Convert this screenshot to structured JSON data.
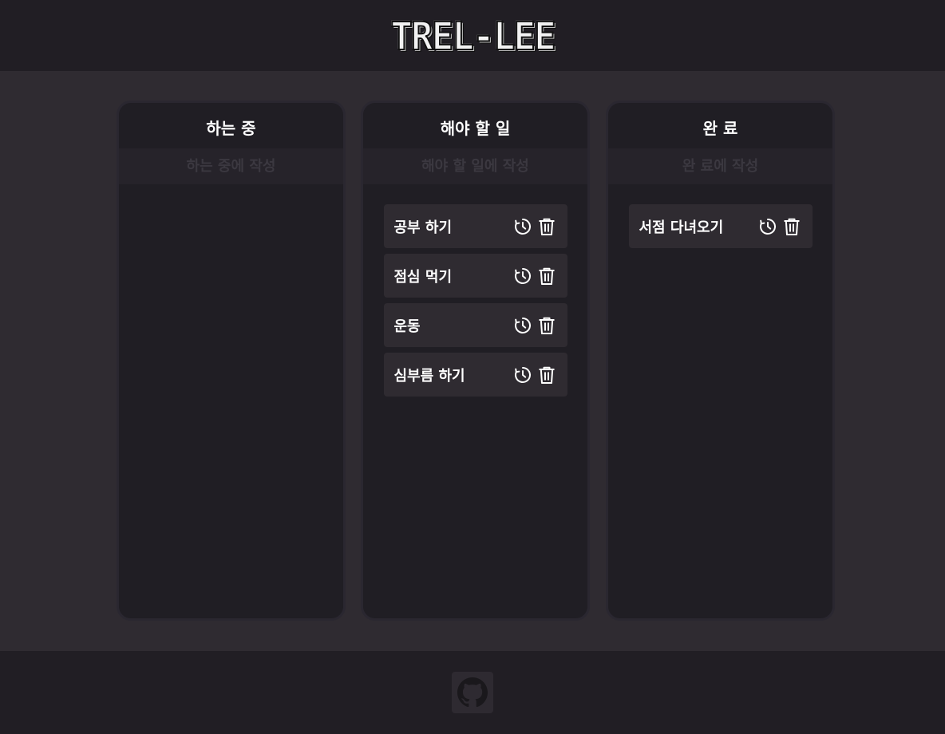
{
  "header": {
    "logo_text": "TREL-LEE"
  },
  "boards": [
    {
      "title": "하는 중",
      "input_placeholder": "하는 중에 작성",
      "cards": []
    },
    {
      "title": "해야 할 일",
      "input_placeholder": "해야 할 일에 작성",
      "cards": [
        {
          "text": "공부 하기"
        },
        {
          "text": "점심 먹기"
        },
        {
          "text": "운동"
        },
        {
          "text": "심부름 하기"
        }
      ]
    },
    {
      "title": "완 료",
      "input_placeholder": "완 료에 작성",
      "cards": [
        {
          "text": "서점 다녀오기"
        }
      ]
    }
  ],
  "icons": {
    "card_action_1": "clock-history-icon",
    "card_action_2": "trash-icon",
    "footer_link": "github-icon"
  },
  "colors": {
    "header_bg": "#211e24",
    "main_bg": "#2f2b31",
    "board_bg": "#201e24",
    "card_bg": "#2f2b31"
  }
}
